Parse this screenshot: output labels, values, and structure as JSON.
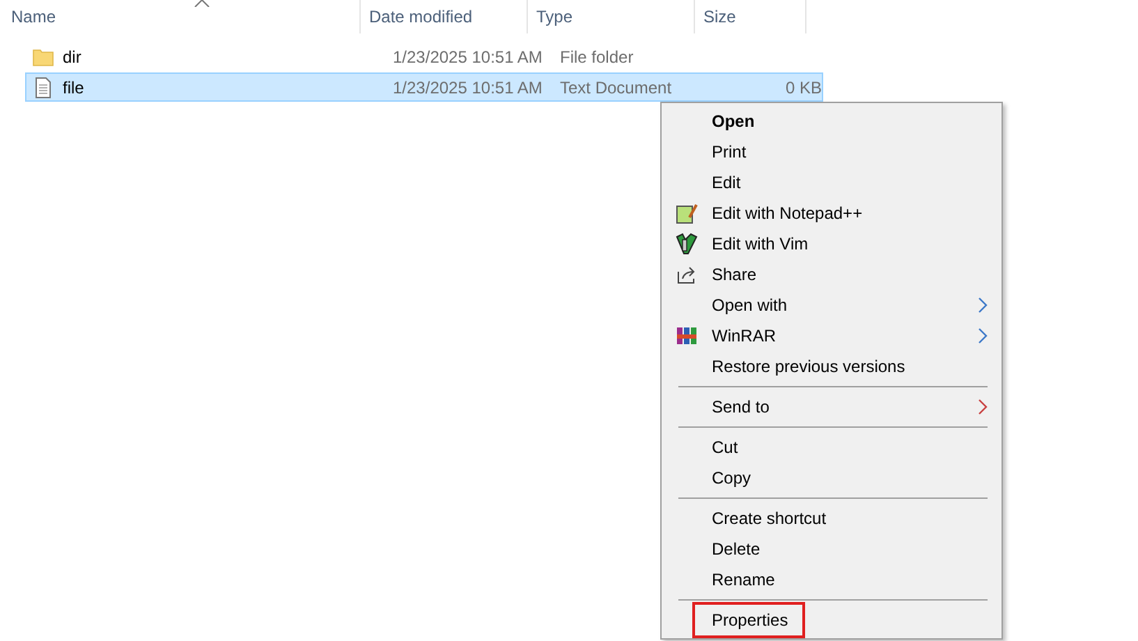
{
  "columns": [
    {
      "label": "Name",
      "sorted": true
    },
    {
      "label": "Date modified"
    },
    {
      "label": "Type"
    },
    {
      "label": "Size"
    }
  ],
  "rows": [
    {
      "kind": "folder",
      "name": "dir",
      "date": "1/23/2025 10:51 AM",
      "type": "File folder",
      "selected": false
    },
    {
      "kind": "text",
      "name": "file",
      "date": "1/23/2025 10:51 AM",
      "type": "Text Document",
      "size": "0 KB",
      "selected": true
    }
  ],
  "context_menu": [
    {
      "kind": "item",
      "label": "Open",
      "bold": true
    },
    {
      "kind": "item",
      "label": "Print"
    },
    {
      "kind": "item",
      "label": "Edit"
    },
    {
      "kind": "item",
      "label": "Edit with Notepad++"
    },
    {
      "kind": "item",
      "label": "Edit with Vim"
    },
    {
      "kind": "item",
      "label": "Share"
    },
    {
      "kind": "item",
      "label": "Open with",
      "submenu": true,
      "color": "#3c78c8"
    },
    {
      "kind": "item",
      "label": "WinRAR",
      "submenu": true,
      "color": "#3c78c8"
    },
    {
      "kind": "item",
      "label": "Restore previous versions"
    },
    {
      "kind": "separator"
    },
    {
      "kind": "item",
      "label": "Send to",
      "submenu": true,
      "color": "#c84040"
    },
    {
      "kind": "separator"
    },
    {
      "kind": "item",
      "label": "Cut"
    },
    {
      "kind": "item",
      "label": "Copy"
    },
    {
      "kind": "separator"
    },
    {
      "kind": "item",
      "label": "Create shortcut"
    },
    {
      "kind": "item",
      "label": "Delete"
    },
    {
      "kind": "item",
      "label": "Rename"
    },
    {
      "kind": "separator"
    },
    {
      "kind": "item",
      "label": "Properties",
      "outlined": true
    }
  ]
}
